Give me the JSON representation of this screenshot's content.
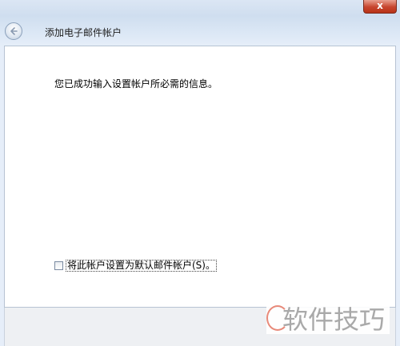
{
  "window": {
    "title": "添加电子邮件帐户",
    "close_glyph": "x"
  },
  "content": {
    "message": "您已成功输入设置帐户所必需的信息。",
    "default_checkbox": {
      "label": "将此帐户设置为默认邮件帐户(S)。",
      "checked": false
    }
  },
  "watermark": {
    "text": "软件技巧"
  },
  "icons": {
    "back": "back-arrow-icon",
    "close": "close-icon"
  },
  "colors": {
    "close_button": "#c7452e",
    "title_bar": "#d6e3f2",
    "watermark": "#a9a9a9"
  }
}
